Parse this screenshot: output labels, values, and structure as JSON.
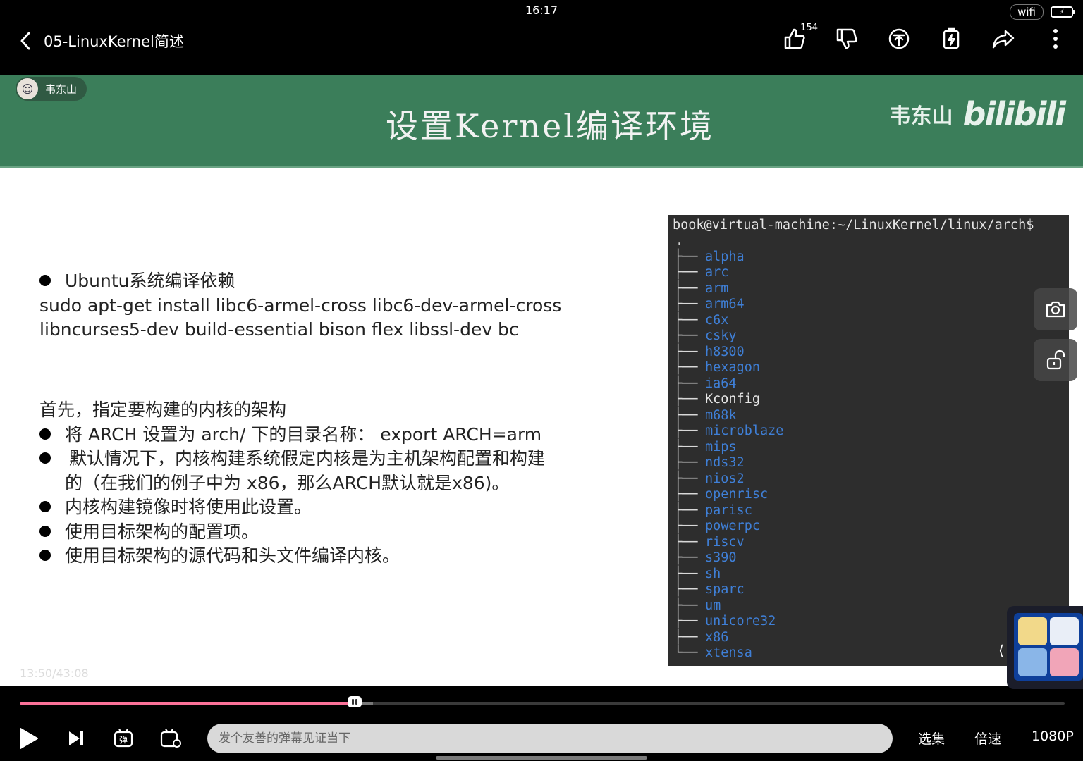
{
  "status": {
    "time": "16:17",
    "wifi": "wifi"
  },
  "header": {
    "title": "05-LinuxKernel简述",
    "like_count": "154"
  },
  "slide": {
    "uploader": "韦东山",
    "title": "设置Kernel编译环境",
    "watermark_name": "韦东山",
    "watermark_logo": "bilibili",
    "deps_title": "Ubuntu系统编译依赖",
    "deps_line1": "sudo apt-get install libc6-armel-cross libc6-dev-armel-cross",
    "deps_line2": "libncurses5-dev build-essential bison flex libssl-dev bc",
    "intro": "首先，指定要构建的内核的架构",
    "bullets": [
      "将 ARCH 设置为 arch/ 下的目录名称：  export  ARCH=arm",
      "默认情况下，内核构建系统假定内核是为主机架构配置和构建",
      "内核构建镜像时将使用此设置。",
      "使用目标架构的配置项。",
      "使用目标架构的源代码和头文件编译内核。"
    ],
    "bullet2_cont": "的（在我们的例子中为 x86，那么ARCH默认就是x86)。"
  },
  "terminal": {
    "prompt": "book@virtual-machine:~/LinuxKernel/linux/arch$",
    "root": ".",
    "entries": [
      {
        "name": "alpha",
        "type": "dir"
      },
      {
        "name": "arc",
        "type": "dir"
      },
      {
        "name": "arm",
        "type": "dir"
      },
      {
        "name": "arm64",
        "type": "dir"
      },
      {
        "name": "c6x",
        "type": "dir"
      },
      {
        "name": "csky",
        "type": "dir"
      },
      {
        "name": "h8300",
        "type": "dir"
      },
      {
        "name": "hexagon",
        "type": "dir"
      },
      {
        "name": "ia64",
        "type": "dir"
      },
      {
        "name": "Kconfig",
        "type": "file"
      },
      {
        "name": "m68k",
        "type": "dir"
      },
      {
        "name": "microblaze",
        "type": "dir"
      },
      {
        "name": "mips",
        "type": "dir"
      },
      {
        "name": "nds32",
        "type": "dir"
      },
      {
        "name": "nios2",
        "type": "dir"
      },
      {
        "name": "openrisc",
        "type": "dir"
      },
      {
        "name": "parisc",
        "type": "dir"
      },
      {
        "name": "powerpc",
        "type": "dir"
      },
      {
        "name": "riscv",
        "type": "dir"
      },
      {
        "name": "s390",
        "type": "dir"
      },
      {
        "name": "sh",
        "type": "dir"
      },
      {
        "name": "sparc",
        "type": "dir"
      },
      {
        "name": "um",
        "type": "dir"
      },
      {
        "name": "unicore32",
        "type": "dir"
      },
      {
        "name": "x86",
        "type": "dir"
      },
      {
        "name": "xtensa",
        "type": "dir"
      }
    ],
    "colors": {
      "dir": "#3f7fd6",
      "file": "#e6e6e6"
    }
  },
  "player": {
    "time": "13:50/43:08",
    "progress_fraction": 0.3208,
    "danmaku_placeholder": "发个友善的弹幕见证当下",
    "episodes_label": "选集",
    "speed_label": "倍速",
    "quality_label": "1080P",
    "accent_color": "#fb7299"
  },
  "icons": {
    "back": "chevron-left-icon",
    "like": "thumbs-up-icon",
    "dislike": "thumbs-down-icon",
    "coin": "coin-icon",
    "favorite": "favorite-icon",
    "share": "share-icon",
    "more": "more-vertical-icon",
    "screenshot": "camera-icon",
    "lock": "unlock-icon",
    "play": "play-icon",
    "next": "next-icon",
    "danmaku_toggle": "danmaku-on-icon",
    "danmaku_settings": "danmaku-settings-icon"
  }
}
